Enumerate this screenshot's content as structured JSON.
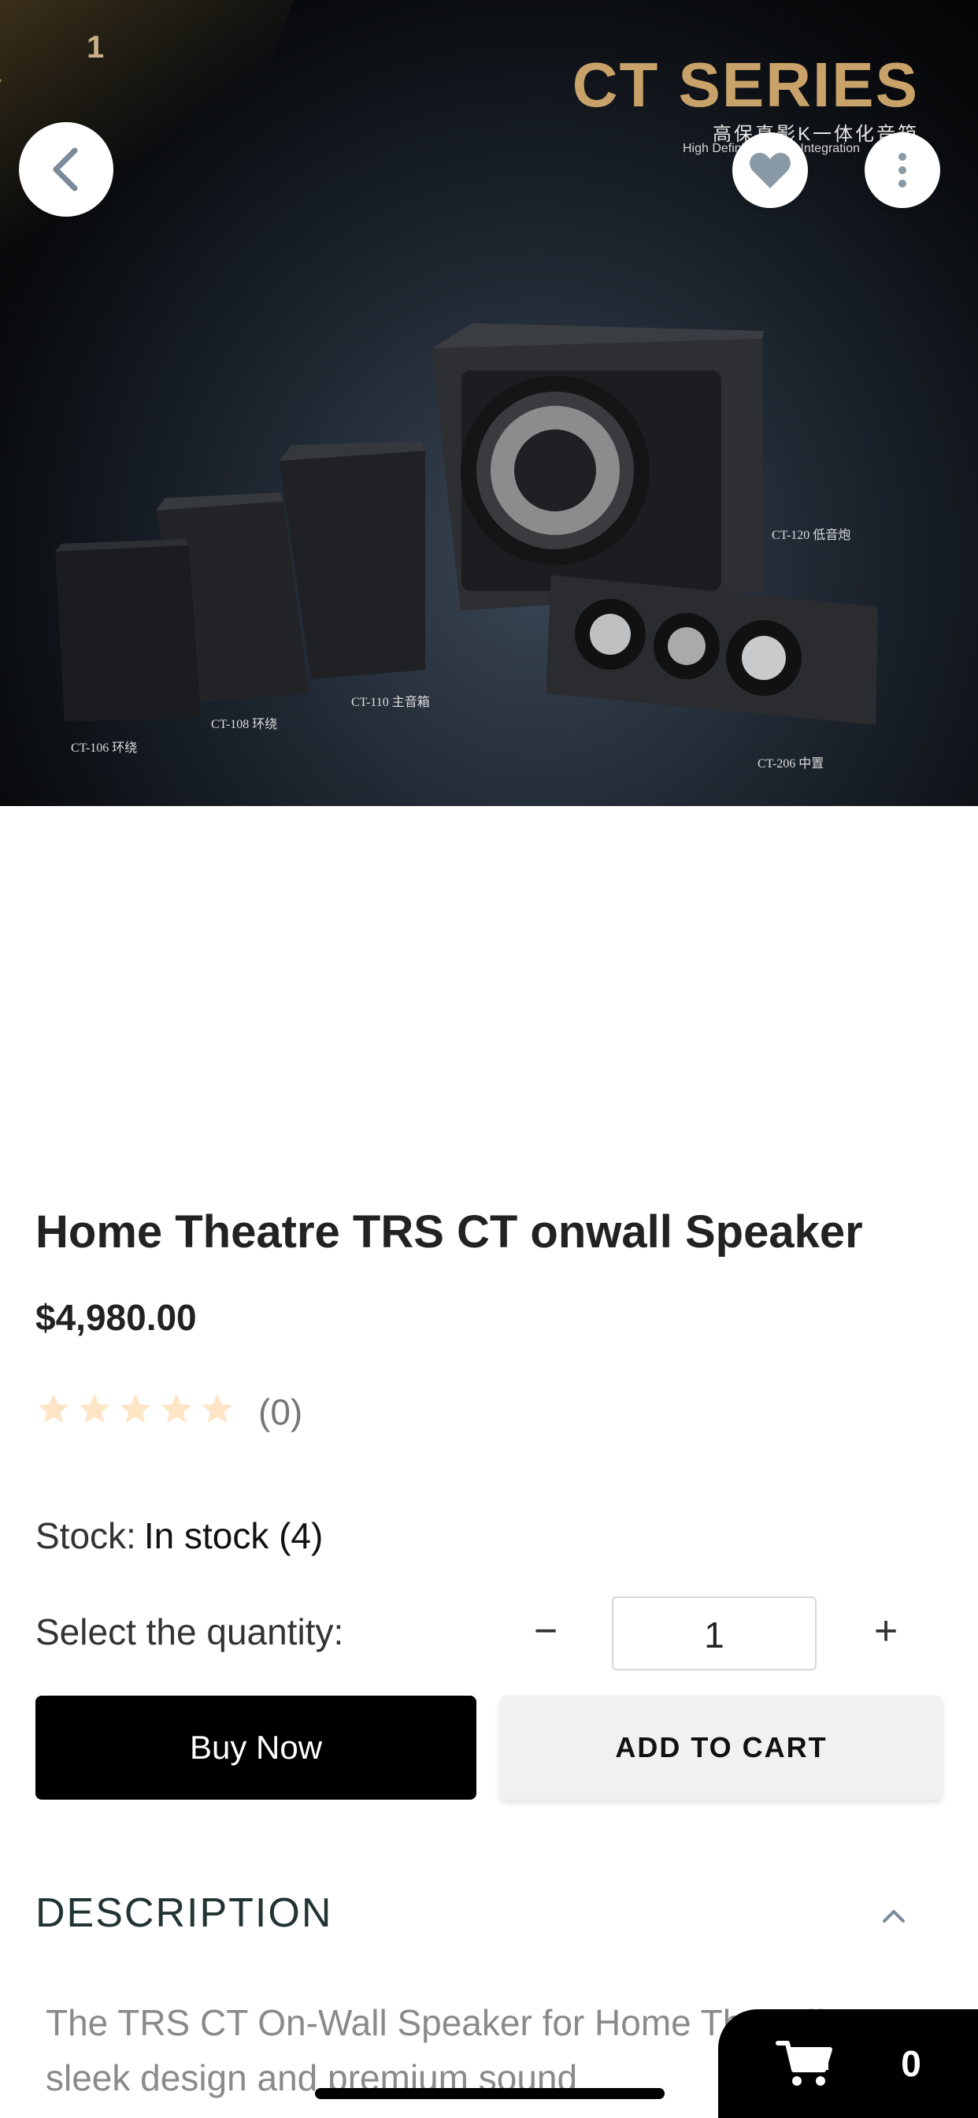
{
  "hero": {
    "badge_text": "1",
    "series_title": "CT SERIES",
    "series_cn": "高保真影K一体化音箱",
    "series_sub": "High Definition ... ter Integration",
    "labels": {
      "ct106": "CT-106 环绕",
      "ct108": "CT-108 环绕",
      "ct110": "CT-110 主音箱",
      "ct120": "CT-120 低音炮",
      "ct206": "CT-206 中置"
    }
  },
  "product": {
    "title": "Home Theatre TRS CT onwall Speaker",
    "price": "$4,980.00",
    "rating": 0,
    "rating_count": "(0)",
    "star_color": "#fde5c6"
  },
  "stock": {
    "label": "Stock:",
    "value": "In stock (4)"
  },
  "quantity": {
    "label": "Select the quantity:",
    "value": "1",
    "minus": "−",
    "plus": "+"
  },
  "buttons": {
    "buy_now": "Buy Now",
    "add_to_cart": "ADD TO CART"
  },
  "description": {
    "title": "DESCRIPTION",
    "text": "The TRS CT On-Wall Speaker for Home Th... offers sleek design and premium sound"
  },
  "cart": {
    "count": "0"
  },
  "icons": {
    "back": "chevron-left-icon",
    "favorite": "heart-icon",
    "more": "vertical-dots-icon",
    "cart": "cart-icon",
    "chevron_up": "chevron-up-icon"
  }
}
